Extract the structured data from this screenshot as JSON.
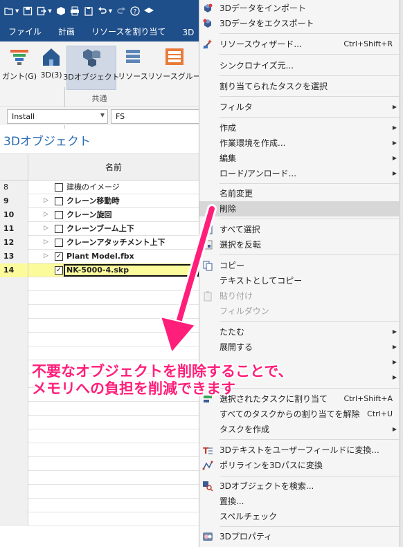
{
  "ribbon": {
    "tabs": [
      "ファイル",
      "計画",
      "リソースを割り当て",
      "3D"
    ],
    "buttons": {
      "gantt": "ガント(G)",
      "threed": "3D(3)",
      "objects": "3Dオブジェクト",
      "resources": "リソース",
      "resource_groups": "リソースグルー"
    },
    "group_label": "共通"
  },
  "filterbar": {
    "combo1": "Install",
    "combo2": "FS"
  },
  "panel": {
    "title": "3Dオブジェクト",
    "column_name": "名前",
    "rows": [
      {
        "num": "8",
        "name": "建機のイメージ",
        "checked": false,
        "expandable": false,
        "light": true
      },
      {
        "num": "9",
        "name": "クレーン移動時",
        "checked": false,
        "expandable": true
      },
      {
        "num": "10",
        "name": "クレーン旋回",
        "checked": false,
        "expandable": true
      },
      {
        "num": "11",
        "name": "クレーンブーム上下",
        "checked": false,
        "expandable": true
      },
      {
        "num": "12",
        "name": "クレーンアタッチメント上下",
        "checked": false,
        "expandable": true
      },
      {
        "num": "13",
        "name": "Plant Model.fbx",
        "checked": true,
        "expandable": true
      },
      {
        "num": "14",
        "name": "NK-5000-4.skp",
        "checked": true,
        "expandable": false,
        "highlight": true
      }
    ]
  },
  "menu": {
    "import_3d": "3Dデータをインポート",
    "export_3d": "3Dデータをエクスポート",
    "resource_wizard": "リソースウィザード...",
    "resource_wizard_shortcut": "Ctrl+Shift+R",
    "synchronize": "シンクロナイズ元...",
    "select_assigned_tasks": "割り当てられたタスクを選択",
    "filter": "フィルタ",
    "create": "作成",
    "create_workspace": "作業環境を作成...",
    "edit": "編集",
    "load_unload": "ロード/アンロード...",
    "rename": "名前変更",
    "delete": "削除",
    "select_all": "すべて選択",
    "invert_selection": "選択を反転",
    "copy": "コピー",
    "copy_as_text": "テキストとしてコピー",
    "paste": "貼り付け",
    "fill_down": "フィルダウン",
    "collapse": "たたむ",
    "expand": "展開する",
    "assign_to_selected": "選択されたタスクに割り当て",
    "assign_to_selected_shortcut": "Ctrl+Shift+A",
    "unassign_all": "すべてのタスクからの割り当てを解除",
    "unassign_all_shortcut": "Ctrl+U",
    "create_task": "タスクを作成",
    "text_to_user_field": "3Dテキストをユーザーフィールドに変換...",
    "polyline_to_path": "ポリラインを3Dパスに変換",
    "search_objects": "3Dオブジェクトを検索...",
    "replace": "置換...",
    "spell_check": "スペルチェック",
    "properties": "3Dプロパティ"
  },
  "annotation": {
    "line1": "不要なオブジェクトを削除することで、",
    "line2": "メモリへの負担を削減できます",
    "color": "#ff1f7a"
  }
}
